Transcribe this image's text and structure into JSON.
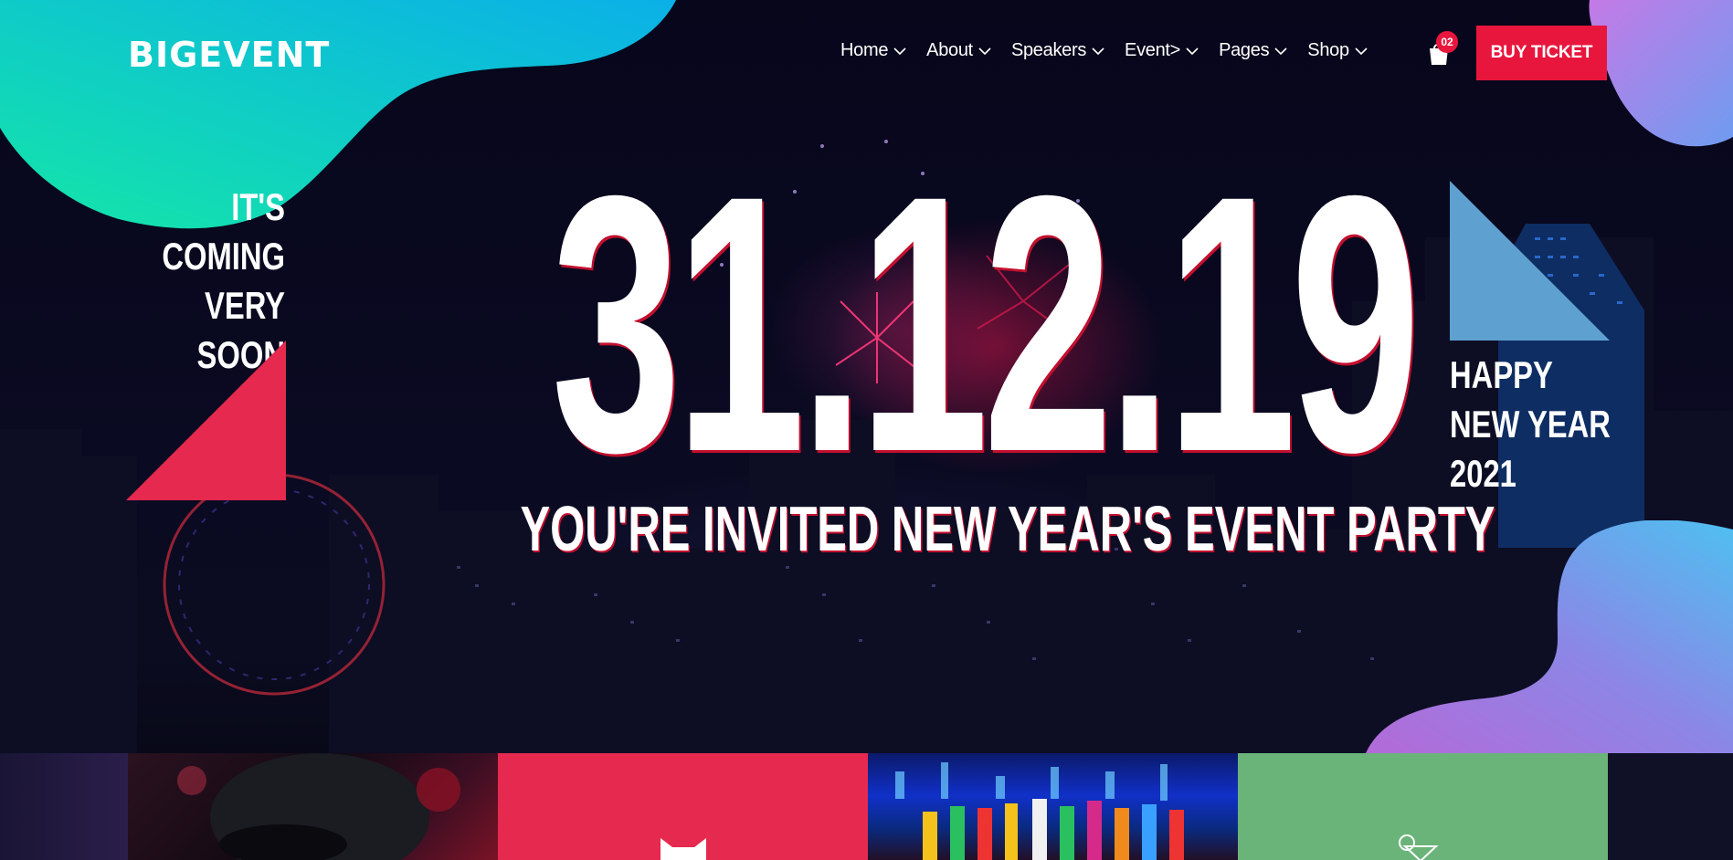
{
  "brand": {
    "logo_text": "BIGEVENT"
  },
  "nav": {
    "items": [
      {
        "label": "Home"
      },
      {
        "label": "About"
      },
      {
        "label": "Speakers"
      },
      {
        "label": "Event>"
      },
      {
        "label": "Pages"
      },
      {
        "label": "Shop"
      }
    ]
  },
  "cart": {
    "count": "02",
    "icon": "shopping-bag-icon"
  },
  "buy_ticket": {
    "label": "BUY TICKET"
  },
  "hero": {
    "left_lines": [
      "IT'S",
      "COMING",
      "VERY SOON"
    ],
    "date": "31.12.19",
    "subtitle": "YOU'RE INVITED NEW YEAR'S EVENT PARTY",
    "right_lines": [
      "HAPPY",
      "NEW YEAR",
      "2021"
    ]
  },
  "colors": {
    "accent": "#e8163d",
    "blob_teal": "#14d6b0",
    "blob_cyan": "#0bb4e6",
    "blob_violet": "#a36ae0",
    "triangle_red": "#e6294f",
    "triangle_blue": "#5ea0d0",
    "tile_green": "#6ab47a"
  },
  "icons": {
    "dropdown": "chevron-down-icon",
    "tile_2": "cat-mask-icon",
    "tile_4": "cocktail-icon"
  }
}
